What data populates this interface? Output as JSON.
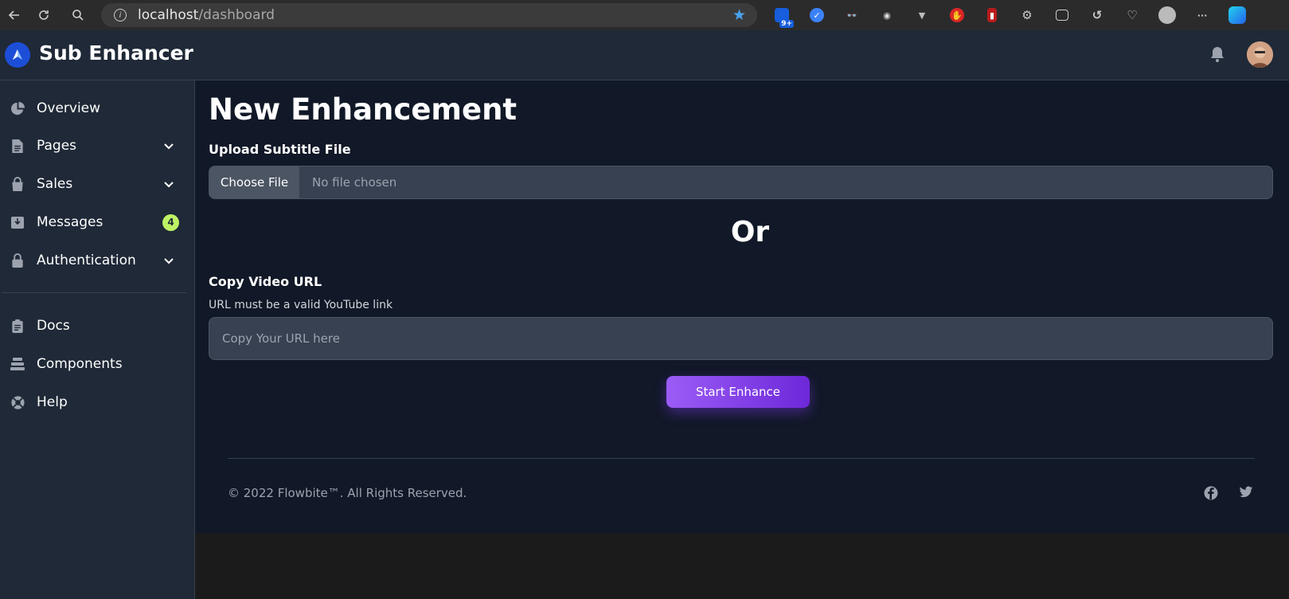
{
  "browser": {
    "url_host": "localhost",
    "url_path": "/dashboard",
    "ext_badge": "9+"
  },
  "app": {
    "brand": "Sub Enhancer"
  },
  "sidebar": {
    "items": [
      {
        "label": "Overview",
        "icon": "pie-chart-icon"
      },
      {
        "label": "Pages",
        "icon": "document-icon",
        "expandable": true
      },
      {
        "label": "Sales",
        "icon": "shopping-bag-icon",
        "expandable": true
      },
      {
        "label": "Messages",
        "icon": "inbox-icon",
        "badge": "4"
      },
      {
        "label": "Authentication",
        "icon": "lock-icon",
        "expandable": true
      }
    ],
    "secondary": [
      {
        "label": "Docs",
        "icon": "clipboard-icon"
      },
      {
        "label": "Components",
        "icon": "stack-icon"
      },
      {
        "label": "Help",
        "icon": "lifebuoy-icon"
      }
    ]
  },
  "main": {
    "title": "New Enhancement",
    "upload_label": "Upload Subtitle File",
    "file_button": "Choose File",
    "file_status": "No file chosen",
    "or_text": "Or",
    "url_label": "Copy Video URL",
    "url_hint": "URL must be a valid YouTube link",
    "url_placeholder": "Copy Your URL here",
    "url_value": "",
    "submit_label": "Start Enhance"
  },
  "footer": {
    "copyright": "© 2022 Flowbite™. All Rights Reserved."
  },
  "colors": {
    "accent": "#7c3aed",
    "badge": "#bef264",
    "sidebar_bg": "#1f2937",
    "main_bg": "#111827"
  }
}
